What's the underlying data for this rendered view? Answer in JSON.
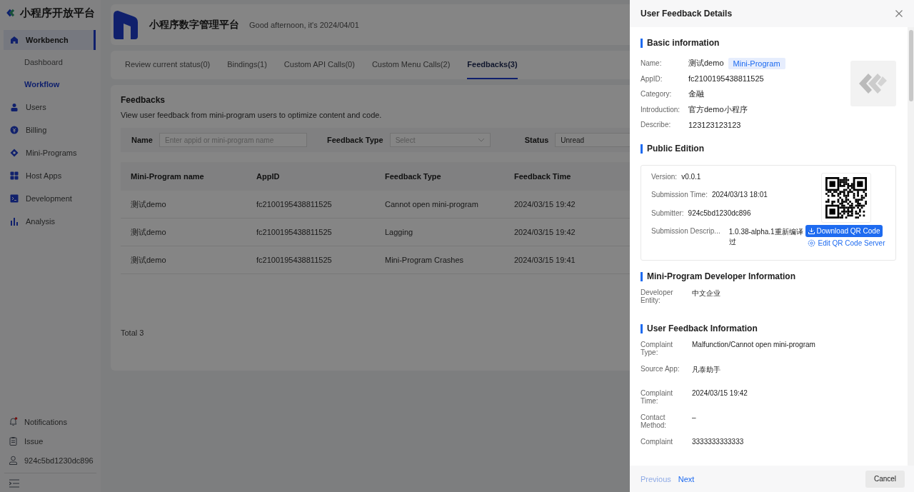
{
  "sidebar": {
    "brand": "小程序开放平台",
    "items": [
      {
        "label": "Workbench",
        "selected": true,
        "children": [
          {
            "label": "Dashboard",
            "selected": false
          },
          {
            "label": "Workflow",
            "selected": true
          }
        ]
      },
      {
        "label": "Users",
        "selected": false
      },
      {
        "label": "Billing",
        "selected": false
      },
      {
        "label": "Mini-Programs",
        "selected": false
      },
      {
        "label": "Host Apps",
        "selected": false
      },
      {
        "label": "Development",
        "selected": false
      },
      {
        "label": "Analysis",
        "selected": false
      }
    ],
    "bottom_items": [
      {
        "label": "Notifications",
        "badge": true
      },
      {
        "label": "Issue",
        "badge": false
      },
      {
        "label": "924c5bd1230dc896",
        "badge": false
      }
    ]
  },
  "header": {
    "title": "小程序数字管理平台",
    "greeting": "Good afternoon, it's  2024/04/01"
  },
  "tabs": [
    {
      "label": "Review current status(0)",
      "selected": false
    },
    {
      "label": "Bindings(1)",
      "selected": false
    },
    {
      "label": "Custom API Calls(0)",
      "selected": false
    },
    {
      "label": "Custom Menu Calls(2)",
      "selected": false
    },
    {
      "label": "Feedbacks(3)",
      "selected": true
    }
  ],
  "feedbacks": {
    "title": "Feedbacks",
    "description": "View user feedback from mini-program users to optimize content and code.",
    "filters": [
      {
        "kind": "text",
        "label": "Name",
        "placeholder": "Enter appid or mini-program name"
      },
      {
        "kind": "select",
        "label": "Feedback Type",
        "placeholder": "Select"
      },
      {
        "kind": "value",
        "label": "Status",
        "value": "Unread"
      }
    ],
    "table": {
      "columns": [
        "Mini-Program name",
        "AppID",
        "Feedback Type",
        "Feedback Time"
      ],
      "rows": [
        [
          "测试demo",
          "fc2100195438811525",
          "Cannot open mini-program",
          "2024/03/15 19:42"
        ],
        [
          "测试demo",
          "fc2100195438811525",
          "Lagging",
          "2024/03/15 19:42"
        ],
        [
          "测试demo",
          "fc2100195438811525",
          "Mini-Program Crashes",
          "2024/03/15 19:41"
        ]
      ]
    },
    "total": "Total 3"
  },
  "drawer": {
    "title": "User Feedback Details",
    "basic": {
      "heading": "Basic information",
      "tag": "Mini-Program",
      "fields": [
        {
          "label": "Name:",
          "value": "测试demo"
        },
        {
          "label": "AppID:",
          "value": "fc2100195438811525"
        },
        {
          "label": "Category:",
          "value": "金融"
        },
        {
          "label": "Introduction:",
          "value": "官方demo小程序"
        },
        {
          "label": "Describe:",
          "value": "123123123123"
        }
      ]
    },
    "edition": {
      "heading": "Public Edition",
      "fields": [
        {
          "label": "Version:",
          "value": "v0.0.1"
        },
        {
          "label": "Submission Time:",
          "value": "2024/03/13 18:01"
        },
        {
          "label": "Submitter:",
          "value": "924c5bd1230dc896"
        },
        {
          "label": "Submission Descrip...",
          "value": "1.0.38-alpha.1重新编译过"
        }
      ],
      "download_button": "Download QR Code",
      "edit_link": "Edit QR Code Server"
    },
    "developer": {
      "heading": "Mini-Program Developer Information",
      "fields": [
        {
          "label": "Developer Entity:",
          "value": "中文企业"
        }
      ]
    },
    "feedback": {
      "heading": "User Feedback Information",
      "fields": [
        {
          "label": "Complaint Type:",
          "value": "Malfunction/Cannot open mini-program"
        },
        {
          "label": "Source App:",
          "value": "凡泰助手"
        },
        {
          "label": "Complaint Time:",
          "value": "2024/03/15 19:42"
        },
        {
          "label": "Contact Method:",
          "value": "–"
        },
        {
          "label": "Complaint",
          "value": "3333333333333"
        }
      ]
    },
    "footer": {
      "previous": {
        "label": "Previous",
        "disabled": true
      },
      "next": {
        "label": "Next",
        "disabled": false
      },
      "cancel": "Cancel"
    }
  }
}
